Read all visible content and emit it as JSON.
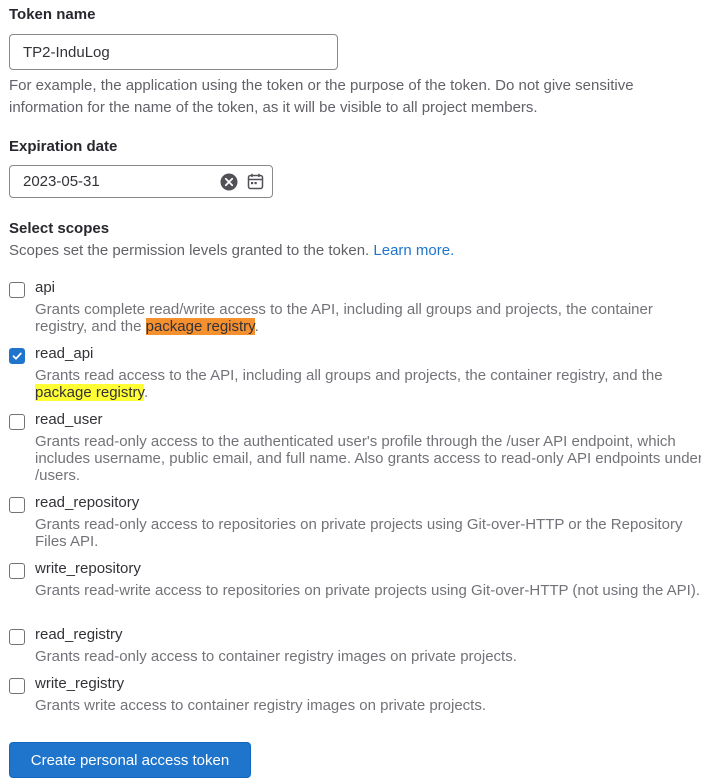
{
  "token_name": {
    "label": "Token name",
    "value": "TP2-InduLog",
    "help": "For example, the application using the token or the purpose of the token. Do not give sensitive information for the name of the token, as it will be visible to all project members."
  },
  "expiration": {
    "label": "Expiration date",
    "value": "2023-05-31",
    "clear_icon": "clear-icon",
    "calendar_icon": "calendar-icon"
  },
  "scopes": {
    "label": "Select scopes",
    "help": "Scopes set the permission levels granted to the token.",
    "learn_more": "Learn more.",
    "items": [
      {
        "name": "api",
        "checked": false,
        "desc": "Grants complete read/write access to the API, including all groups and projects, the container registry, and the ",
        "highlight": "package registry",
        "desc_end": "."
      },
      {
        "name": "read_api",
        "checked": true,
        "desc": "Grants read access to the API, including all groups and projects, the container registry, and the ",
        "highlight": "package registry",
        "desc_end": "."
      },
      {
        "name": "read_user",
        "checked": false,
        "desc": "Grants read-only access to the authenticated user's profile through the /user API endpoint, which includes username, public email, and full name. Also grants access to read-only API endpoints under /users."
      },
      {
        "name": "read_repository",
        "checked": false,
        "desc": "Grants read-only access to repositories on private projects using Git-over-HTTP or the Repository Files API."
      },
      {
        "name": "write_repository",
        "checked": false,
        "desc": "Grants read-write access to repositories on private projects using Git-over-HTTP (not using the API)."
      },
      {
        "name": "read_registry",
        "checked": false,
        "desc": "Grants read-only access to container registry images on private projects."
      },
      {
        "name": "write_registry",
        "checked": false,
        "desc": "Grants write access to container registry images on private projects."
      }
    ]
  },
  "submit": {
    "label": "Create personal access token"
  },
  "colors": {
    "accent": "#1f75cb",
    "highlight_orange": "#f5902f",
    "highlight_yellow": "#ffff33"
  }
}
